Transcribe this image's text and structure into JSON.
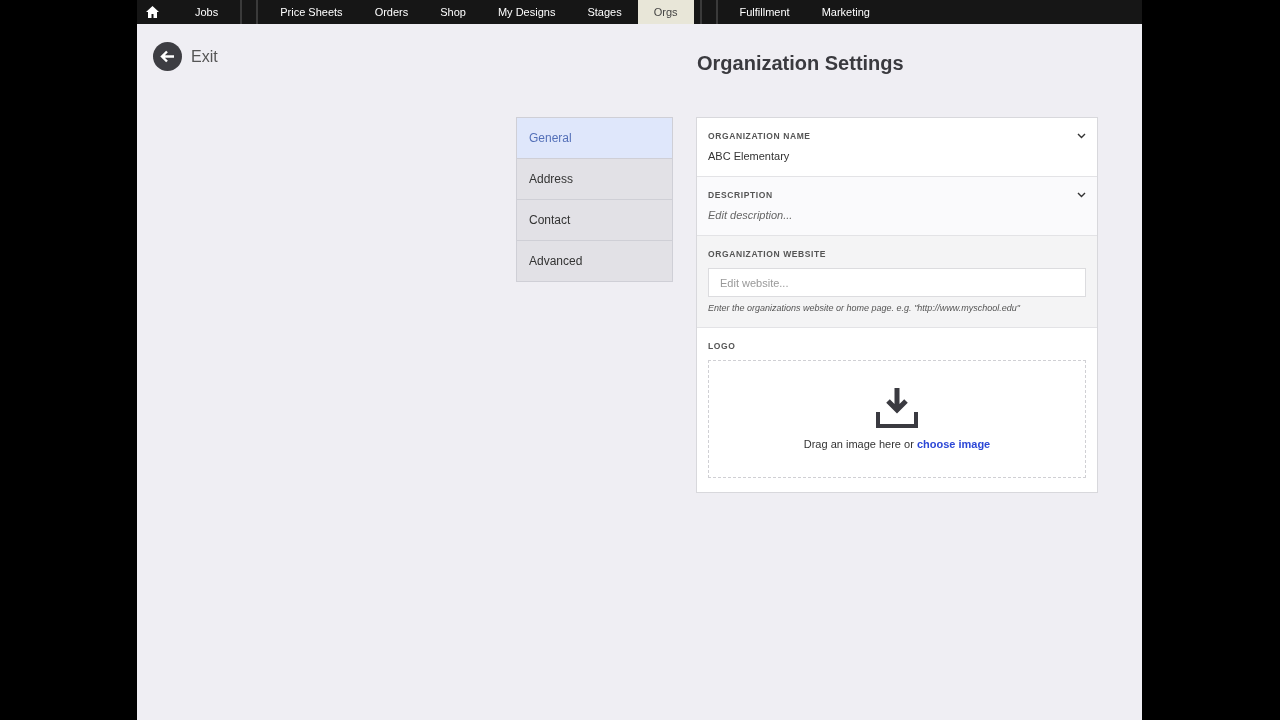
{
  "nav": {
    "items": [
      {
        "label": "Jobs",
        "selected": false,
        "separator_before": false
      },
      {
        "label": "Price Sheets",
        "selected": false,
        "separator_before": true
      },
      {
        "label": "Orders",
        "selected": false,
        "separator_before": false
      },
      {
        "label": "Shop",
        "selected": false,
        "separator_before": false
      },
      {
        "label": "My Designs",
        "selected": false,
        "separator_before": false
      },
      {
        "label": "Stages",
        "selected": false,
        "separator_before": false
      },
      {
        "label": "Orgs",
        "selected": true,
        "separator_before": false
      },
      {
        "label": "Fulfillment",
        "selected": false,
        "separator_before": true
      },
      {
        "label": "Marketing",
        "selected": false,
        "separator_before": false
      }
    ]
  },
  "exit": {
    "label": "Exit"
  },
  "title": "Organization Settings",
  "sidebar": {
    "items": [
      {
        "label": "General",
        "selected": true
      },
      {
        "label": "Address",
        "selected": false
      },
      {
        "label": "Contact",
        "selected": false
      },
      {
        "label": "Advanced",
        "selected": false
      }
    ]
  },
  "sections": [
    {
      "kind": "value",
      "label": "ORGANIZATION NAME",
      "value": "ABC Elementary"
    },
    {
      "kind": "editable",
      "label": "DESCRIPTION",
      "placeholder": "Edit description..."
    },
    {
      "kind": "input",
      "label": "ORGANIZATION WEBSITE",
      "placeholder": "Edit website...",
      "hint": "Enter the organizations website or home page. e.g. \"http://www.myschool.edu\""
    },
    {
      "kind": "upload",
      "label": "LOGO",
      "text": "Drag an image here or",
      "link": "choose image"
    }
  ]
}
